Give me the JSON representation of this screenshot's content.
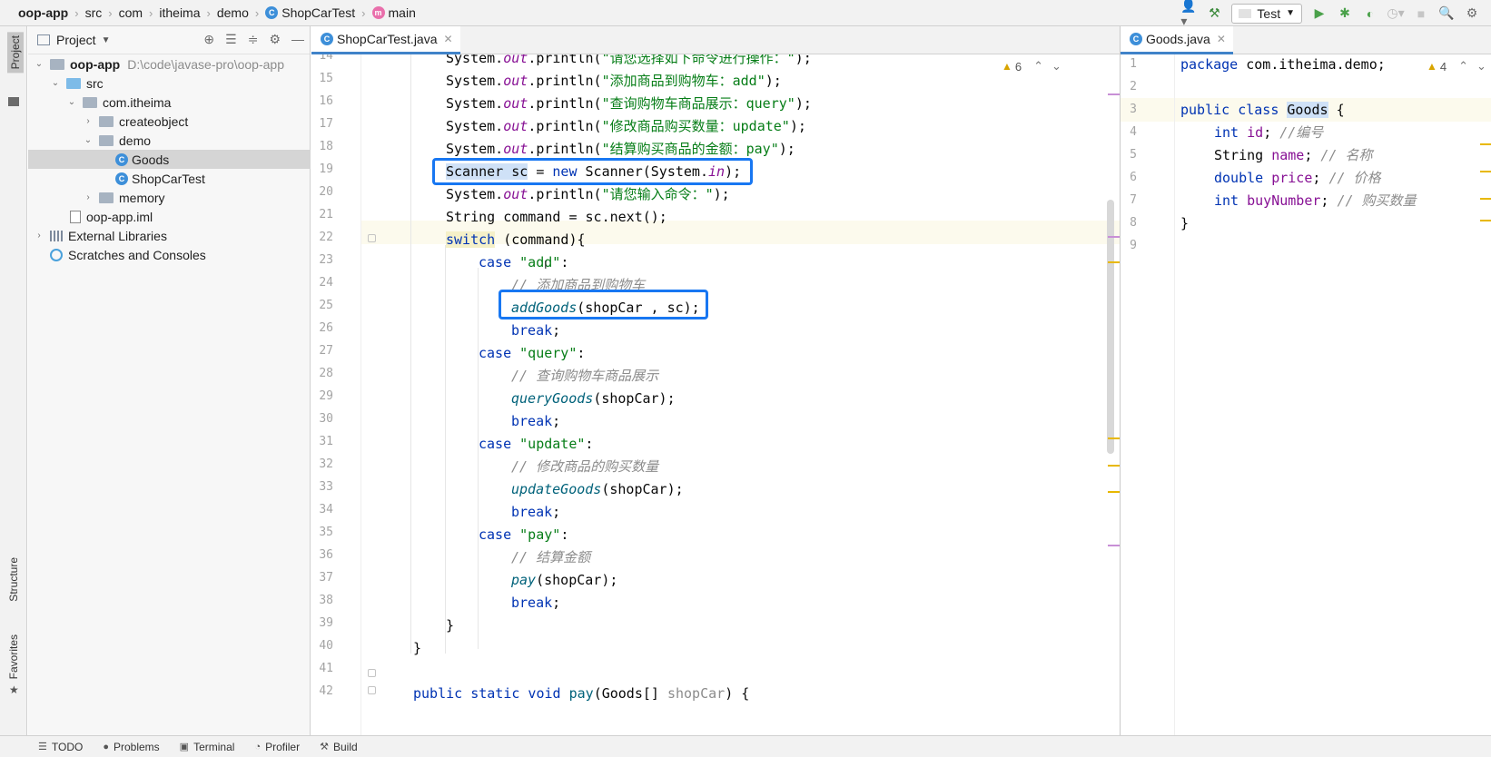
{
  "breadcrumbs": [
    {
      "label": "oop-app"
    },
    {
      "label": "src"
    },
    {
      "label": "com"
    },
    {
      "label": "itheima"
    },
    {
      "label": "demo"
    },
    {
      "label": "ShopCarTest",
      "icon": "class-icon"
    },
    {
      "label": "main",
      "icon": "method-icon"
    }
  ],
  "run_config": {
    "label": "Test"
  },
  "left_strip": {
    "project": "Project",
    "structure": "Structure",
    "favorites": "Favorites"
  },
  "project_panel": {
    "title": "Project",
    "tree": [
      {
        "label": "oop-app",
        "path": "D:\\code\\javase-pro\\oop-app",
        "arrow": "⌄",
        "icon": "module-folder"
      },
      {
        "label": "src",
        "arrow": "⌄",
        "icon": "source-folder"
      },
      {
        "label": "com.itheima",
        "arrow": "⌄",
        "icon": "package-folder"
      },
      {
        "label": "createobject",
        "arrow": "›",
        "icon": "package-folder"
      },
      {
        "label": "demo",
        "arrow": "⌄",
        "icon": "package-folder"
      },
      {
        "label": "Goods",
        "arrow": "",
        "icon": "class-icon",
        "selected": true
      },
      {
        "label": "ShopCarTest",
        "arrow": "",
        "icon": "class-icon"
      },
      {
        "label": "memory",
        "arrow": "›",
        "icon": "package-folder"
      },
      {
        "label": "oop-app.iml",
        "arrow": "",
        "icon": "file-icon"
      },
      {
        "label": "External Libraries",
        "arrow": "›",
        "icon": "library-icon"
      },
      {
        "label": "Scratches and Consoles",
        "arrow": "",
        "icon": "scratch-icon"
      }
    ]
  },
  "main_editor": {
    "tab": "ShopCarTest.java",
    "warnings": "6",
    "line_numbers": [
      "14",
      "15",
      "16",
      "17",
      "18",
      "19",
      "20",
      "21",
      "22",
      "23",
      "24",
      "25",
      "26",
      "27",
      "28",
      "29",
      "30",
      "31",
      "32",
      "33",
      "34",
      "35",
      "36",
      "37",
      "38",
      "39",
      "40",
      "41",
      "42"
    ],
    "code": {
      "l14": {
        "a": "System.",
        "b": "out",
        "c": ".println(",
        "d": "\"请您选择如下命令进行操作：\"",
        "e": ");"
      },
      "l15": {
        "a": "System.",
        "b": "out",
        "c": ".println(",
        "d": "\"添加商品到购物车：add\"",
        "e": ");"
      },
      "l16": {
        "a": "System.",
        "b": "out",
        "c": ".println(",
        "d": "\"查询购物车商品展示：query\"",
        "e": ");"
      },
      "l17": {
        "a": "System.",
        "b": "out",
        "c": ".println(",
        "d": "\"修改商品购买数量：update\"",
        "e": ");"
      },
      "l18": {
        "a": "System.",
        "b": "out",
        "c": ".println(",
        "d": "\"结算购买商品的金额：pay\"",
        "e": ");"
      },
      "l19": {
        "a": "Scanner sc",
        "b": " = ",
        "c": "new",
        "d": " Scanner(System.",
        "e": "in",
        "f": ");"
      },
      "l20": {
        "a": "System.",
        "b": "out",
        "c": ".println(",
        "d": "\"请您输入命令：\"",
        "e": ");"
      },
      "l21": {
        "a": "String command = sc.next();"
      },
      "l22": {
        "a": "switch",
        "b": " (command){"
      },
      "l23": {
        "a": "case",
        "b": " ",
        "c": "\"add\"",
        "d": ":"
      },
      "l24": {
        "a": "// 添加商品到购物车"
      },
      "l25": {
        "a": "addGoods",
        "b": "(shopCar , sc);"
      },
      "l26": {
        "a": "break",
        "b": ";"
      },
      "l27": {
        "a": "case",
        "b": " ",
        "c": "\"query\"",
        "d": ":"
      },
      "l28": {
        "a": "// 查询购物车商品展示"
      },
      "l29": {
        "a": "queryGoods",
        "b": "(shopCar);"
      },
      "l30": {
        "a": "break",
        "b": ";"
      },
      "l31": {
        "a": "case",
        "b": " ",
        "c": "\"update\"",
        "d": ":"
      },
      "l32": {
        "a": "// 修改商品的购买数量"
      },
      "l33": {
        "a": "updateGoods",
        "b": "(shopCar);"
      },
      "l34": {
        "a": "break",
        "b": ";"
      },
      "l35": {
        "a": "case",
        "b": " ",
        "c": "\"pay\"",
        "d": ":"
      },
      "l36": {
        "a": "// 结算金额"
      },
      "l37": {
        "a": "pay",
        "b": "(shopCar);"
      },
      "l38": {
        "a": "break",
        "b": ";"
      },
      "l39": {
        "a": "}"
      },
      "l40": {
        "a": "}"
      },
      "l42": {
        "a": "public static void",
        "b": " ",
        "c": "pay",
        "d": "(Goods[] ",
        "e": "shopCar",
        "f": ") {"
      }
    }
  },
  "side_editor": {
    "tab": "Goods.java",
    "warnings": "4",
    "line_numbers": [
      "1",
      "2",
      "3",
      "4",
      "5",
      "6",
      "7",
      "8",
      "9"
    ],
    "code": {
      "l1": {
        "a": "package",
        "b": " com.itheima.demo;"
      },
      "l3": {
        "a": "public class",
        "b": " ",
        "c": "Goods",
        "d": " {"
      },
      "l4": {
        "a": "int",
        "b": " ",
        "c": "id",
        "d": "; ",
        "e": "//编号"
      },
      "l5": {
        "a": "String ",
        "c": "name",
        "d": "; ",
        "e": "// 名称"
      },
      "l6": {
        "a": "double",
        "b": " ",
        "c": "price",
        "d": "; ",
        "e": "// 价格"
      },
      "l7": {
        "a": "int",
        "b": " ",
        "c": "buyNumber",
        "d": "; ",
        "e": "// 购买数量"
      },
      "l8": {
        "a": "}"
      }
    }
  },
  "statusbar": {
    "todo": "TODO",
    "problems": "Problems",
    "terminal": "Terminal",
    "profiler": "Profiler",
    "build": "Build"
  },
  "colors": {
    "accent": "#1877f2",
    "keyword": "#0033b3",
    "string": "#067d17",
    "field": "#871094",
    "comment": "#8c8c8c"
  }
}
